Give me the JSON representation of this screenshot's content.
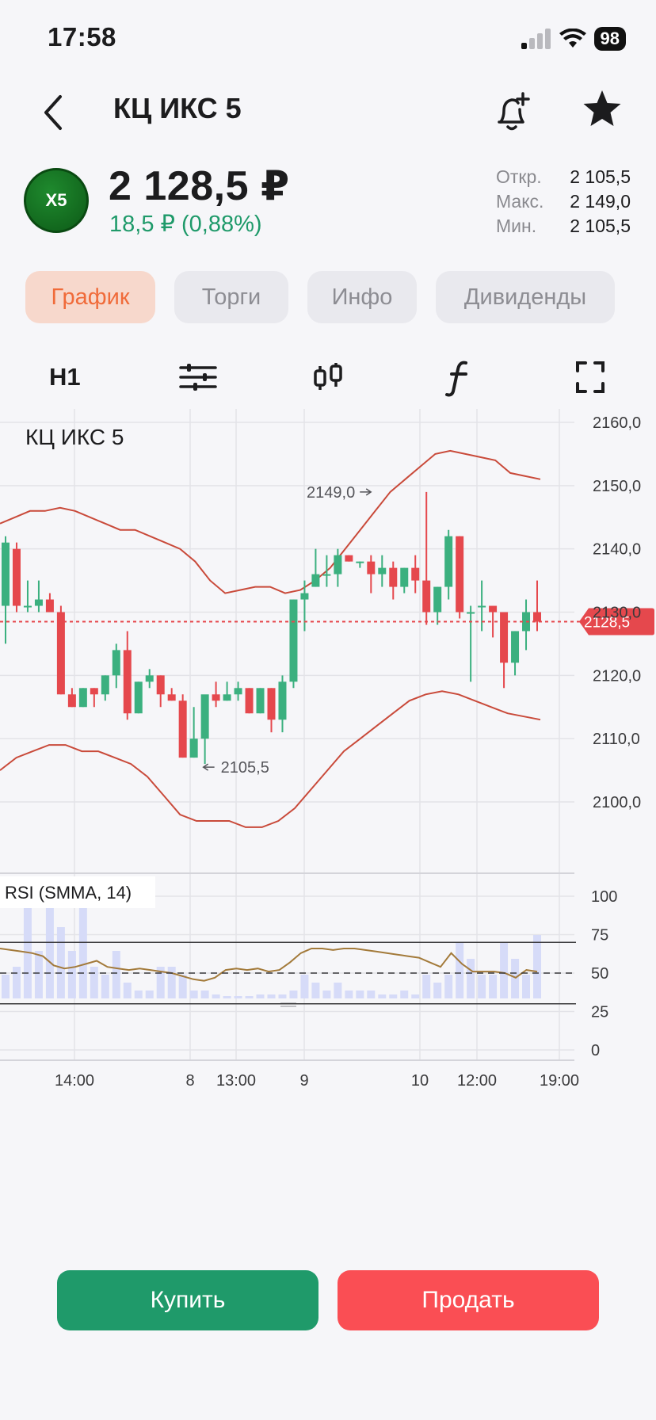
{
  "status": {
    "time": "17:58",
    "battery": "98"
  },
  "nav": {
    "title": "КЦ ИКС 5"
  },
  "quote": {
    "logo_text": "X5",
    "price": "2 128,5 ₽",
    "change": "18,5 ₽ (0,88%)",
    "open_label": "Откр.",
    "open": "2 105,5",
    "high_label": "Макс.",
    "high": "2 149,0",
    "low_label": "Мин.",
    "low": "2 105,5"
  },
  "tabs": [
    "График",
    "Торги",
    "Инфо",
    "Дивиденды"
  ],
  "toolbar": {
    "interval": "H1"
  },
  "chart": {
    "title": "КЦ ИКС 5",
    "current_price_label": "2128,5",
    "high_annotation": "2149,0",
    "low_annotation": "2105,5",
    "price_ticks": [
      "2160,0",
      "2150,0",
      "2140,0",
      "2130,0",
      "2120,0",
      "2110,0",
      "2100,0"
    ],
    "rsi_label": "RSI (SMMA, 14)",
    "rsi_ticks": [
      "100",
      "75",
      "50",
      "25",
      "0"
    ],
    "time_ticks": [
      "14:00",
      "8",
      "13:00",
      "9",
      "10",
      "12:00",
      "19:00"
    ],
    "colors": {
      "up": "#3bb07f",
      "down": "#e5484d",
      "bands": "#c94a3a",
      "rsi": "#a37a3a",
      "volume": "#d6dbf8"
    }
  },
  "chart_data": {
    "type": "candlestick",
    "series": [
      {
        "name": "price",
        "candles": [
          [
            2131,
            2142,
            2125,
            2141
          ],
          [
            2140,
            2141,
            2130,
            2131
          ],
          [
            2131,
            2135,
            2130,
            2131
          ],
          [
            2131,
            2135,
            2130,
            2132
          ],
          [
            2132,
            2133,
            2130,
            2130
          ],
          [
            2130,
            2131,
            2117,
            2117
          ],
          [
            2117,
            2118,
            2115,
            2115
          ],
          [
            2115,
            2118,
            2115,
            2118
          ],
          [
            2118,
            2118,
            2115,
            2117
          ],
          [
            2117,
            2120,
            2116,
            2120
          ],
          [
            2120,
            2125,
            2118,
            2124
          ],
          [
            2124,
            2127,
            2113,
            2114
          ],
          [
            2114,
            2119,
            2114,
            2119
          ],
          [
            2119,
            2121,
            2118,
            2120
          ],
          [
            2120,
            2120,
            2115,
            2117
          ],
          [
            2117,
            2118,
            2116,
            2116
          ],
          [
            2116,
            2117,
            2107,
            2107
          ],
          [
            2107,
            2115,
            2107,
            2110
          ],
          [
            2110,
            2112,
            2106,
            2117
          ],
          [
            2117,
            2119,
            2115,
            2116
          ],
          [
            2116,
            2119,
            2116,
            2117
          ],
          [
            2117,
            2119,
            2116,
            2118
          ],
          [
            2118,
            2118,
            2114,
            2114
          ],
          [
            2114,
            2118,
            2114,
            2118
          ],
          [
            2118,
            2118,
            2111,
            2113
          ],
          [
            2113,
            2120,
            2111,
            2119
          ],
          [
            2119,
            2132,
            2118,
            2132
          ],
          [
            2132,
            2135,
            2127,
            2133
          ],
          [
            2134,
            2140,
            2134,
            2136
          ],
          [
            2136,
            2139,
            2134,
            2136
          ],
          [
            2136,
            2140,
            2134,
            2139
          ],
          [
            2139,
            2139,
            2138,
            2138
          ],
          [
            2138,
            2138,
            2137,
            2138
          ],
          [
            2138,
            2139,
            2133,
            2136
          ],
          [
            2136,
            2139,
            2134,
            2137
          ],
          [
            2137,
            2138,
            2132,
            2134
          ],
          [
            2134,
            2137,
            2133,
            2137
          ],
          [
            2137,
            2139,
            2133,
            2135
          ],
          [
            2135,
            2149,
            2128,
            2130
          ],
          [
            2130,
            2134,
            2128,
            2134
          ],
          [
            2134,
            2143,
            2132,
            2142
          ],
          [
            2142,
            2142,
            2129,
            2130
          ],
          [
            2130,
            2131,
            2119,
            2130
          ],
          [
            2131,
            2135,
            2127,
            2131
          ],
          [
            2131,
            2131,
            2126,
            2130
          ],
          [
            2130,
            2130,
            2118,
            2122
          ],
          [
            2122,
            2127,
            2120,
            2127
          ],
          [
            2127,
            2132,
            2124,
            2130
          ],
          [
            2130,
            2135,
            2127,
            2128.5
          ]
        ]
      },
      {
        "name": "upper_band",
        "values": [
          2144,
          2145,
          2146,
          2146,
          2146.5,
          2146,
          2145,
          2144,
          2143,
          2143,
          2142,
          2141,
          2140,
          2138,
          2135,
          2133,
          2133.5,
          2134,
          2134,
          2133,
          2133.5,
          2135,
          2137,
          2140,
          2143,
          2146,
          2149,
          2151,
          2153,
          2155,
          2155.5,
          2155,
          2154.5,
          2154,
          2152,
          2151.5,
          2151
        ]
      },
      {
        "name": "lower_band",
        "values": [
          2105,
          2107,
          2108,
          2109,
          2109,
          2108,
          2108,
          2107,
          2106,
          2104,
          2101,
          2098,
          2097,
          2097,
          2097,
          2096,
          2096,
          2097,
          2099,
          2102,
          2105,
          2108,
          2110,
          2112,
          2114,
          2116,
          2117,
          2117.5,
          2117,
          2116,
          2115,
          2114,
          2113.5,
          2113
        ]
      },
      {
        "name": "RSI (SMMA, 14)",
        "values": [
          66,
          65,
          64,
          63,
          61,
          55,
          53,
          54,
          56,
          58,
          54,
          53,
          52,
          53,
          52,
          51,
          50,
          48,
          46,
          45,
          47,
          52,
          53,
          52,
          53,
          51,
          52,
          57,
          63,
          66,
          66,
          65,
          66,
          66,
          65,
          64,
          63,
          62,
          61,
          60,
          57,
          54,
          63,
          56,
          51,
          51,
          51,
          50,
          47,
          52,
          51
        ]
      },
      {
        "name": "volume",
        "values": [
          3,
          4,
          14,
          6,
          13,
          9,
          6,
          12,
          4,
          3,
          6,
          2,
          1,
          1,
          4,
          4,
          3,
          1,
          1,
          0.5,
          0.3,
          0.3,
          0.3,
          0.5,
          0.5,
          0.5,
          1,
          3,
          2,
          1,
          2,
          1,
          1,
          1,
          0.5,
          0.5,
          1,
          0.5,
          3,
          2,
          3,
          7,
          5,
          3,
          3,
          7,
          5,
          3,
          8
        ]
      }
    ],
    "ylim": [
      2090,
      2162
    ],
    "rsi_levels": [
      70,
      50,
      30
    ]
  }
}
